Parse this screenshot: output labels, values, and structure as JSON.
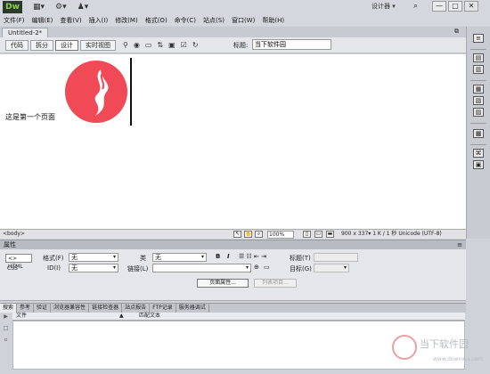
{
  "app": {
    "logo": "Dw",
    "workspace": "设计器 ▾",
    "window_buttons": [
      "—",
      "□",
      "✕"
    ]
  },
  "menu": [
    "文件(F)",
    "编辑(E)",
    "查看(V)",
    "插入(I)",
    "修改(M)",
    "格式(O)",
    "命令(C)",
    "站点(S)",
    "窗口(W)",
    "帮助(H)"
  ],
  "document": {
    "tab": "Untitled-2*"
  },
  "toolbar": {
    "views": [
      "代码",
      "拆分",
      "设计",
      "实时视图"
    ],
    "active_view": "设计",
    "title_label": "标题:",
    "title_value": "当下软件园"
  },
  "design": {
    "page_text": "这是第一个页面"
  },
  "status": {
    "tag": "<body>",
    "zoom": "100%",
    "info": "900 x 337▾ 1 K / 1 秒 Unicode (UTF-8)"
  },
  "properties": {
    "header": "属性",
    "html_mode": "<> HTML",
    "css_mode": "CSS",
    "format_label": "格式(F)",
    "format_value": "无",
    "class_label": "类",
    "class_value": "无",
    "id_label": "ID(I)",
    "id_value": "无",
    "link_label": "链接(L)",
    "link_value": "",
    "bold_label": "B",
    "italic_label": "I",
    "title_label": "标题(T)",
    "target_label": "目标(G)",
    "page_props_button": "页面属性...",
    "list_item_button": "列表项目..."
  },
  "results": {
    "tabs": [
      "搜索",
      "参考",
      "验证",
      "浏览器兼容性",
      "链接检查器",
      "站点报告",
      "FTP记录",
      "服务器调试"
    ],
    "columns": [
      "文件",
      "匹配文本"
    ]
  },
  "watermark": {
    "text": "当下软件园",
    "url": "www.downxia.com"
  }
}
